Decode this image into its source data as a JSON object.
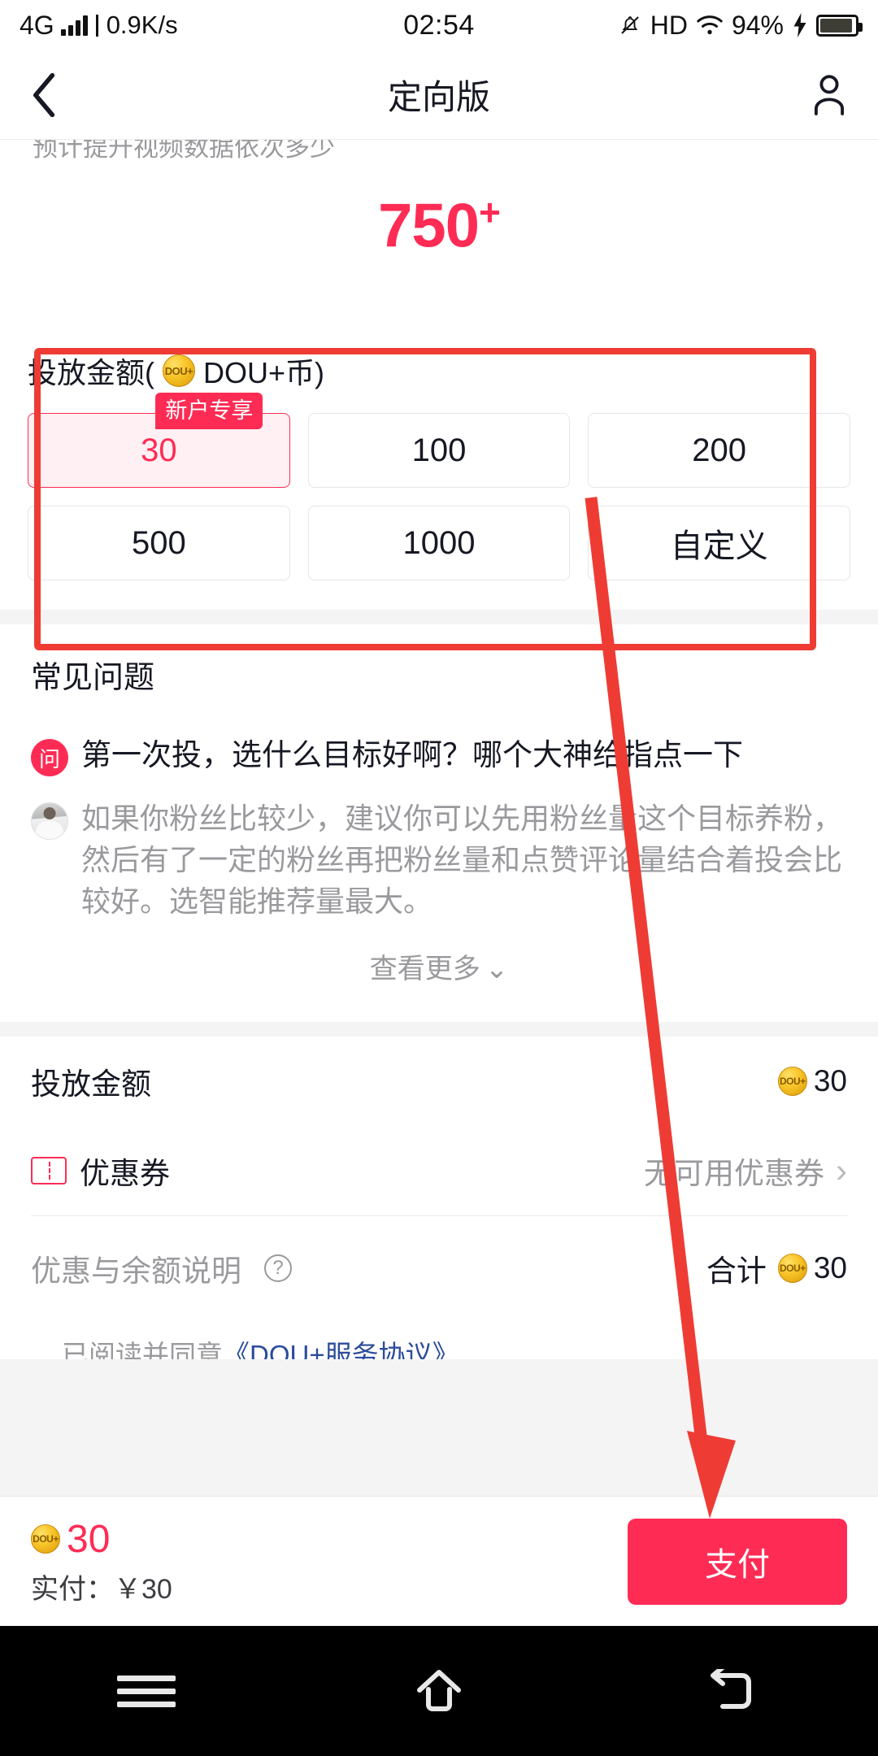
{
  "status_bar": {
    "network_type": "4G",
    "speed": "0.9K/s",
    "time": "02:54",
    "hd": "HD",
    "battery_percent": "94%",
    "icons": [
      "signal-bars-icon",
      "mute-bell-icon",
      "hd-icon",
      "wifi-icon",
      "charging-bolt-icon",
      "battery-icon"
    ]
  },
  "header": {
    "title": "定向版",
    "back_icon": "chevron-left-icon",
    "profile_icon": "person-icon"
  },
  "promo": {
    "clipped_text": "预计提升视频数据依次多少",
    "estimate_value": "750",
    "estimate_suffix": "+"
  },
  "amount_section": {
    "label_prefix": "投放金额(",
    "coin_icon_text": "DOU+",
    "label_suffix": "DOU+币)",
    "options": [
      {
        "value": "30",
        "selected": true,
        "badge": "新户专享"
      },
      {
        "value": "100",
        "selected": false,
        "badge": ""
      },
      {
        "value": "200",
        "selected": false,
        "badge": ""
      },
      {
        "value": "500",
        "selected": false,
        "badge": ""
      },
      {
        "value": "1000",
        "selected": false,
        "badge": ""
      },
      {
        "value": "自定义",
        "selected": false,
        "badge": ""
      }
    ]
  },
  "faq": {
    "title": "常见问题",
    "question_badge": "问",
    "question": "第一次投，选什么目标好啊？哪个大神给指点一下",
    "answer": "如果你粉丝比较少，建议你可以先用粉丝量这个目标养粉，然后有了一定的粉丝再把粉丝量和点赞评论量结合着投会比较好。选智能推荐量最大。",
    "more_label": "查看更多",
    "more_chevron": "⌄"
  },
  "summary": {
    "amount_label": "投放金额",
    "amount_value": "30",
    "coupon_label": "优惠券",
    "coupon_value": "无可用优惠券",
    "coupon_chevron": "›",
    "note_label": "优惠与余额说明",
    "note_help": "?",
    "total_word": "合计",
    "total_value": "30",
    "agreement": "已阅读并同意",
    "agreement_link": "《DOU+服务协议》"
  },
  "pay_bar": {
    "coin_value": "30",
    "actual_label": "实付：￥30",
    "pay_button": "支付"
  },
  "nav_bar": {
    "menu_icon": "hamburger-menu-icon",
    "home_icon": "home-icon",
    "back_icon": "back-arrow-icon"
  },
  "annotation": {
    "highlight_color": "#ee3c34",
    "arrow_color": "#ee3c34"
  },
  "colors": {
    "accent": "#fe2c55",
    "annotation": "#ee3c34",
    "coin_gold": "#f7c325",
    "muted_text": "#9a9a9e"
  }
}
